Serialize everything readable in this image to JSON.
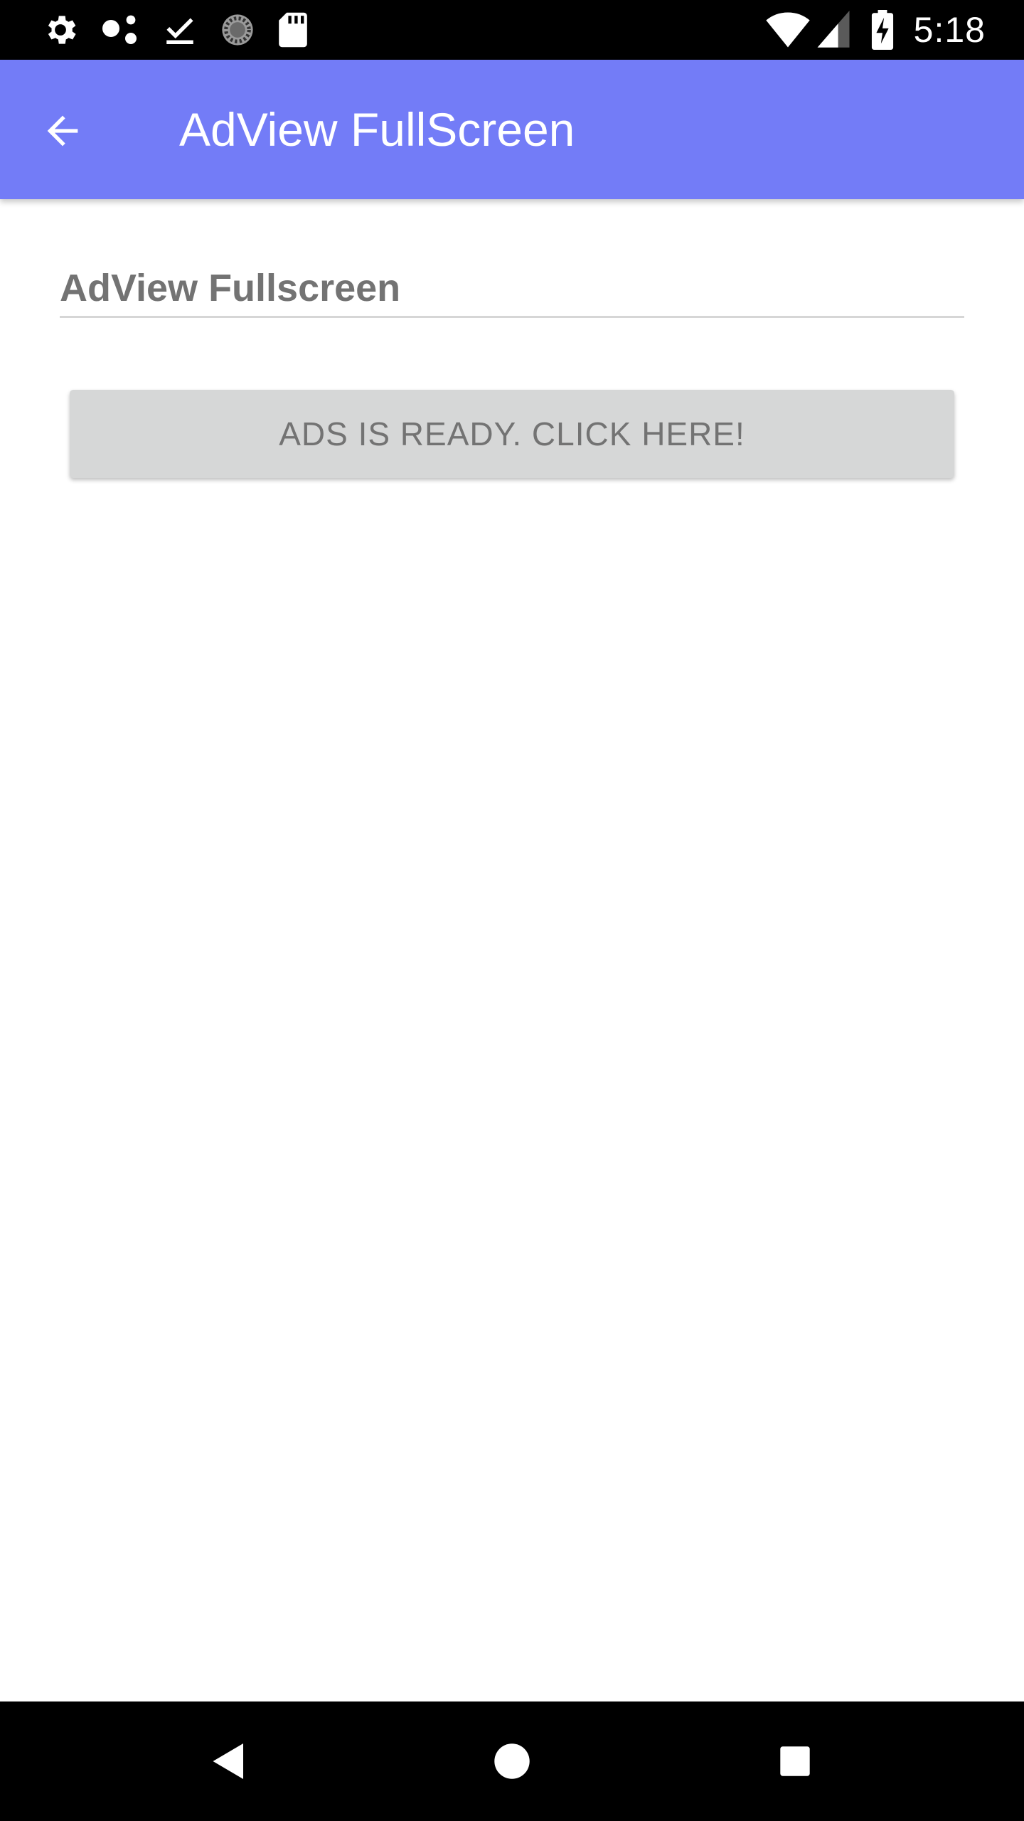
{
  "status_bar": {
    "time": "5:18",
    "left_icons": [
      "settings-icon",
      "assistant-dots-icon",
      "download-done-icon",
      "sync-loading-icon",
      "sd-card-icon"
    ],
    "right_icons": [
      "wifi-icon",
      "cell-signal-icon",
      "battery-charging-icon"
    ]
  },
  "app_bar": {
    "title": "AdView FullScreen",
    "back_icon": "arrow-back-icon",
    "color": "#737cf7"
  },
  "content": {
    "edit_text_value": "AdView Fullscreen",
    "ads_button_label": "ADS IS READY. CLICK HERE!"
  },
  "nav_bar": {
    "icons": [
      "nav-back-icon",
      "nav-home-icon",
      "nav-recents-icon"
    ]
  }
}
